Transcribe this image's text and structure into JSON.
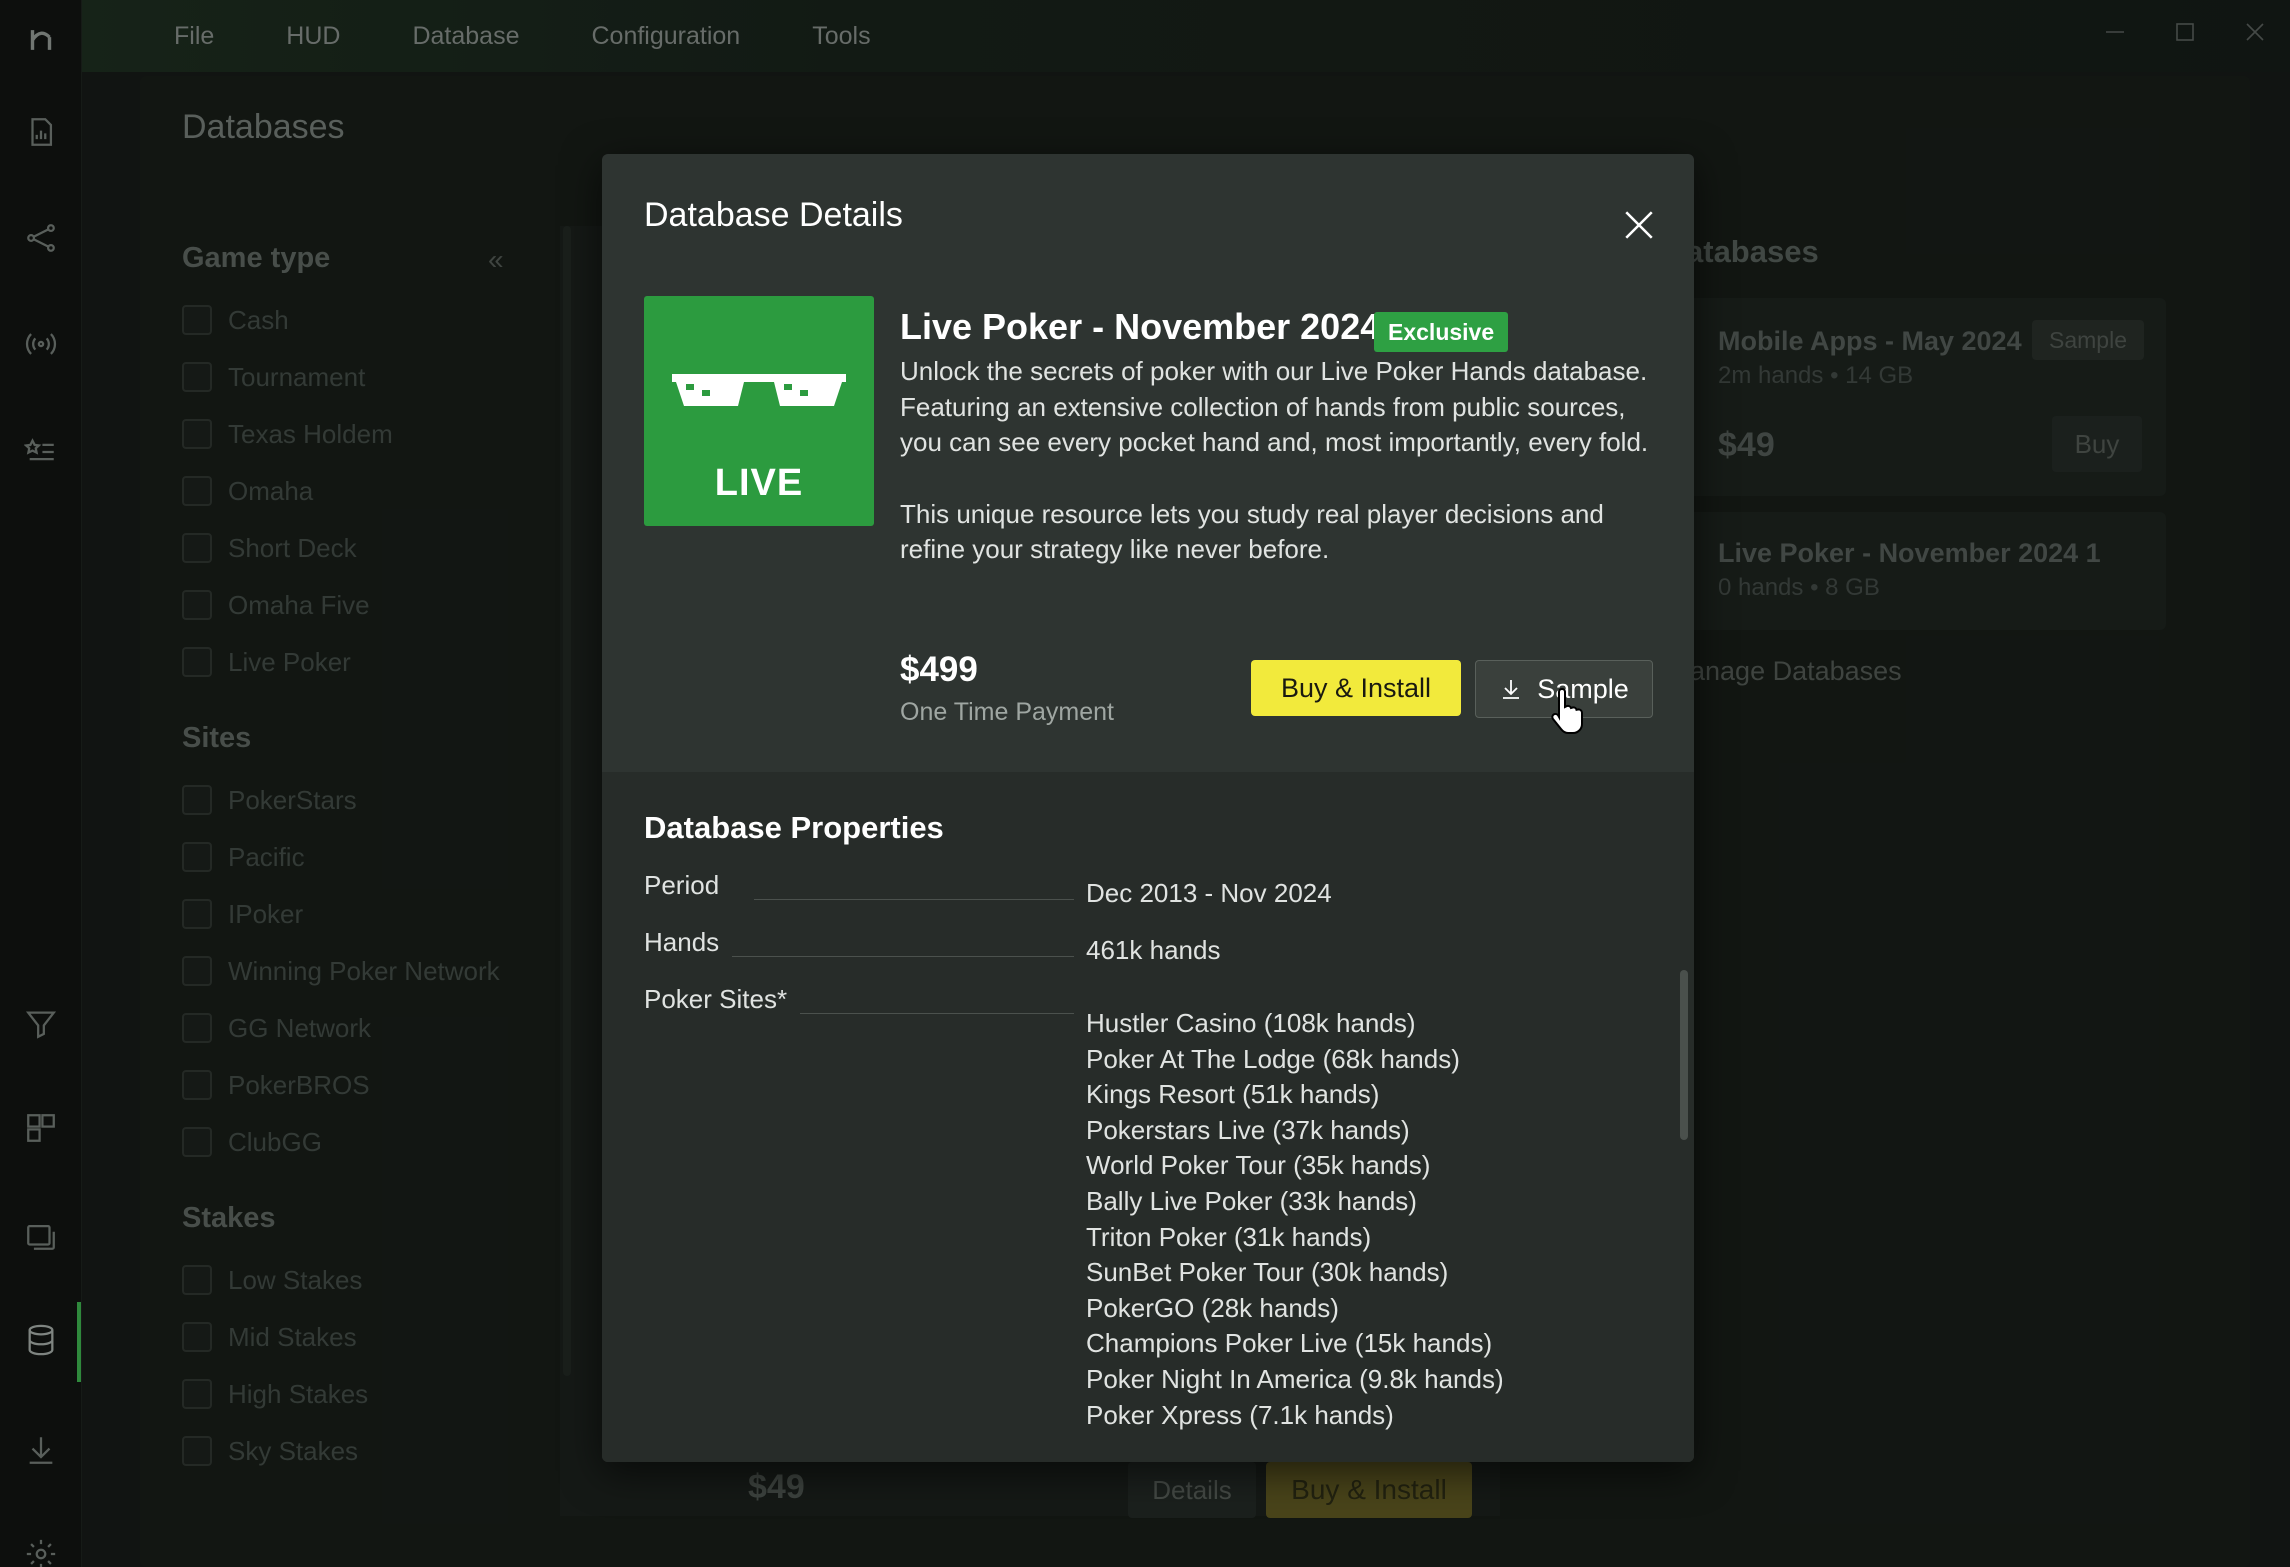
{
  "menu": {
    "items": [
      "File",
      "HUD",
      "Database",
      "Configuration",
      "Tools"
    ]
  },
  "page": {
    "title": "Databases"
  },
  "filters": {
    "game_type": {
      "title": "Game type",
      "items": [
        "Cash",
        "Tournament",
        "Texas Holdem",
        "Omaha",
        "Short Deck",
        "Omaha Five",
        "Live Poker"
      ]
    },
    "sites": {
      "title": "Sites",
      "items": [
        "PokerStars",
        "Pacific",
        "IPoker",
        "Winning Poker Network",
        "GG Network",
        "PokerBROS",
        "ClubGG"
      ]
    },
    "stakes": {
      "title": "Stakes",
      "items": [
        "Low Stakes",
        "Mid Stakes",
        "High Stakes",
        "Sky Stakes"
      ]
    }
  },
  "background_list": {
    "price": "$49",
    "details_label": "Details",
    "buy_label": "Buy & Install"
  },
  "right_panel": {
    "title": "atabases",
    "cards": [
      {
        "name": "Mobile Apps - May 2024",
        "meta": "2m hands • 14 GB",
        "badge": "Sample",
        "price": "$49",
        "buy_label": "Buy"
      },
      {
        "name": "Live Poker - November 2024 1",
        "meta": "0 hands • 8 GB"
      }
    ],
    "manage_link": "lanage Databases"
  },
  "modal": {
    "title": "Database Details",
    "thumbnail_label": "LIVE",
    "name": "Live Poker - November 2024",
    "badge": "Exclusive",
    "description_1": "Unlock the secrets of poker with our Live Poker Hands database. Featuring an extensive collection of hands from public sources, you can see every pocket hand and, most importantly, every fold.",
    "description_2": "This unique resource lets you study real player decisions and refine your strategy like never before.",
    "price": "$499",
    "price_note": "One Time Payment",
    "buy_label": "Buy & Install",
    "sample_label": "Sample",
    "properties": {
      "title": "Database Properties",
      "period_label": "Period",
      "period_value": "Dec 2013 - Nov 2024",
      "hands_label": "Hands",
      "hands_value": "461k hands",
      "sites_label": "Poker Sites*",
      "sites": [
        "Hustler Casino (108k hands)",
        "Poker At The Lodge (68k hands)",
        "Kings Resort (51k hands)",
        "Pokerstars Live (37k hands)",
        "World Poker Tour (35k hands)",
        "Bally Live Poker (33k hands)",
        "Triton Poker (31k hands)",
        "SunBet Poker Tour (30k hands)",
        "PokerGO (28k hands)",
        "Champions Poker Live (15k hands)",
        "Poker Night In America (9.8k hands)",
        "Poker Xpress (7.1k hands)"
      ]
    }
  },
  "colors": {
    "accent_green": "#2ea043",
    "buy_yellow": "#f2ea3c",
    "modal_bg": "#2e3431"
  }
}
